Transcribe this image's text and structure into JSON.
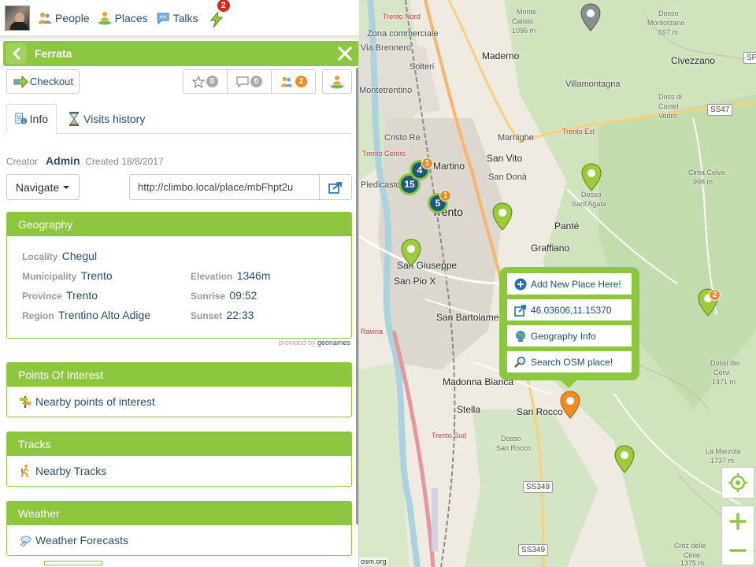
{
  "topbar": {
    "people_label": "People",
    "places_label": "Places",
    "talks_label": "Talks",
    "notif_count": "2"
  },
  "panel": {
    "title": "Ferrata",
    "checkout_label": "Checkout",
    "rating_count": "0",
    "comments_count": "0",
    "people_count": "2",
    "tabs": [
      {
        "label": "Info"
      },
      {
        "label": "Visits history"
      }
    ],
    "meta": {
      "creator_label": "Creator",
      "creator_name": "Admin",
      "created_label": "Created",
      "created_date": "18/8/2017"
    },
    "navigate_label": "Navigate",
    "url": "http://climbo.local/place/mbFhpt2u",
    "geography": {
      "title": "Geography",
      "locality_label": "Locality",
      "locality": "Chegul",
      "municipality_label": "Municipality",
      "municipality": "Trento",
      "province_label": "Province",
      "province": "Trento",
      "region_label": "Region",
      "region": "Trentino Alto Adige",
      "elevation_label": "Elevation",
      "elevation": "1346m",
      "sunrise_label": "Sunrise",
      "sunrise": "09:52",
      "sunset_label": "Sunset",
      "sunset": "22:33",
      "credit_prefix": "provided by",
      "credit_name": "geonames"
    },
    "poi": {
      "title": "Points Of Interest",
      "link": "Nearby points of interest"
    },
    "tracks": {
      "title": "Tracks",
      "link": "Nearby Tracks"
    },
    "weather": {
      "title": "Weather",
      "link": "Weather Forecasts"
    }
  },
  "popup": {
    "add_place": "Add New Place Here!",
    "coords": "46.03606,11.15370",
    "geo_info": "Geography Info",
    "search_osm": "Search OSM place!"
  },
  "map": {
    "attribution": "osm.org",
    "labels": {
      "trento_nord": "Trento Nord",
      "zona_commerciale": "Zona commerciale",
      "via_brennero": "Via Brennero",
      "monte_calisio": "Monte",
      "calisio": "Calisio",
      "calisio_elev": "1096 m",
      "dosso_montorzano": "Dosso",
      "montorzano": "Montorzano",
      "montorzano_elev": "697 m",
      "sp_tag": "SP",
      "maderno": "Maderno",
      "civezzano": "Civezzano",
      "solteri": "Solteri",
      "villamontagna": "Villamontagna",
      "doss_di": "Doss di",
      "castel_vedro": "Castel",
      "vedro": "Vedro",
      "ss47": "SS47",
      "montetrentino": "Montetrentino",
      "cristo_re": "Cristo Re",
      "marnighe": "Marnighe",
      "trento_est": "Trento Est",
      "trento_centro": "Trento Centro",
      "martino": "Martino",
      "san_vito": "San Vito",
      "cima_celva": "Cima Celva",
      "cima_celva_elev": "998 m",
      "piedicastello": "Piedicasto",
      "san_dona": "San Donà",
      "dosso_santagata": "Dosso",
      "santagata": "Sant'Agata",
      "trento": "Trento",
      "pante": "Panté",
      "san_giuseppe": "San Giuseppe",
      "san_pio_x": "San Pio X",
      "graffiano": "Graffiano",
      "san_bartolameo": "San Bartolame",
      "ravina": "Ravina",
      "dossi_dei": "Dossi dei",
      "corvi": "Corvi",
      "corvi_elev": "1471 m",
      "madonna_bianca": "Madonna Bianca",
      "stella": "Stella",
      "san_rocco": "San Rocco",
      "trento_sud": "Trento Sud",
      "dosso_san_rocco": "Dosso",
      "san_rocco_b": "San Rocco",
      "la_marzola": "La Marzola",
      "marzola_elev": "1737 m",
      "ss349": "SS349",
      "ss349b": "SS349",
      "croz_delle": "Croz delle",
      "cime": "Cime",
      "cime_elev": "1375 m"
    },
    "clusters": [
      {
        "count": "15"
      },
      {
        "count": "4",
        "badge": "1"
      },
      {
        "count": "5",
        "badge": "1"
      }
    ],
    "pin_badge": "2"
  },
  "colors": {
    "brand_green": "#8dc63f",
    "link_blue": "#2a4d6e",
    "badge_orange": "#f08a24",
    "notif_red": "#d9261c"
  }
}
